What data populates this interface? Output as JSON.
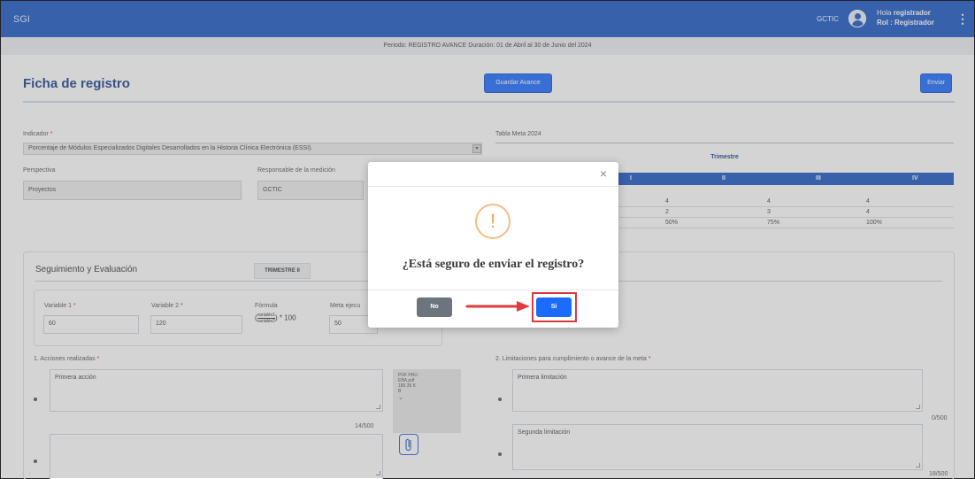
{
  "header": {
    "app_name": "SGI",
    "org": "GCTIC",
    "greeting_prefix": "Hola ",
    "user": "registrador",
    "role": "Rol : Registrador",
    "menu_icon": "kebab-menu-icon"
  },
  "period": "Periodo: REGISTRO AVANCE Duración: 01 de Abril al 30 de Junio del 2024",
  "page": {
    "title": "Ficha de registro",
    "save_label": "Guardar Avance",
    "send_label": "Enviar"
  },
  "indicator": {
    "label": "Indicador",
    "required": "*",
    "value": "Porcentaje de Módulos Especializados Digitales Desarrollados en la Historia Clínica Electrónica (ESSI)."
  },
  "perspective": {
    "label": "Perspectiva",
    "value": "Proyectos"
  },
  "responsible": {
    "label": "Responsable de la medición",
    "value": "GCTIC"
  },
  "meta_table": {
    "title": "Tabla Meta 2024",
    "group_header": "Trimestre",
    "columns": [
      "I",
      "II",
      "III",
      "IV"
    ],
    "rows": [
      [
        "4",
        "4",
        "4"
      ],
      [
        "2",
        "3",
        "4"
      ],
      [
        "50%",
        "75%",
        "100%"
      ]
    ]
  },
  "tracking": {
    "title": "Seguimiento y Evaluación",
    "trimester": "TRIMESTRE II",
    "variable1": {
      "label": "Variable 1",
      "value": "60"
    },
    "variable2": {
      "label": "Variable 2",
      "value": "120"
    },
    "formula": {
      "label": "Fórmula",
      "numerator": "variable1",
      "denominator": "variable2",
      "suffix": ") * 100",
      "prefix": "("
    },
    "meta": {
      "label": "Meta ejecu",
      "value": "50"
    }
  },
  "actions": {
    "label": "1. Acciones realizadas",
    "items": [
      {
        "value": "Primera acción",
        "counter": "14/500"
      },
      {
        "value": "",
        "counter": ""
      }
    ],
    "file": {
      "name_lines": [
        "PDF PRU",
        "EBA.pdf",
        "180.35 K",
        "B"
      ]
    }
  },
  "limitations": {
    "label": "2. Limitaciones para cumplimiento o avance de la meta",
    "items": [
      {
        "value": "Primera limitación",
        "counter": "0/500"
      },
      {
        "value": "Segunda limitación",
        "counter": "18/500"
      }
    ]
  },
  "modal": {
    "icon": "!",
    "question": "¿Está seguro de enviar el registro?",
    "no_label": "No",
    "yes_label": "Si",
    "close_icon": "×"
  },
  "colors": {
    "brand": "#1a56c4",
    "primary_button": "#1b6bff",
    "warning": "#f8bb86",
    "highlight": "#d9383e"
  }
}
